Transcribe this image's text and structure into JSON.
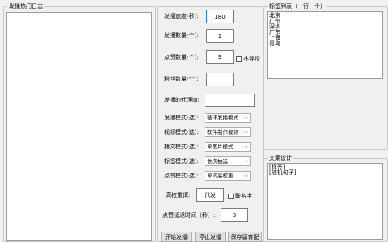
{
  "log_panel": {
    "title": "发播热门日志"
  },
  "settings": {
    "send_speed": {
      "label": "发播速度(秒):",
      "value": "180"
    },
    "send_count": {
      "label": "发播数量(个):",
      "value": "1"
    },
    "like_count": {
      "label": "点赞数量(个):",
      "value": "9"
    },
    "no_comment": {
      "label": "不评论"
    },
    "fans_count": {
      "label": "粉丝数量(个):",
      "value": ""
    },
    "proxy_ip": {
      "label": "发播的代理ip:",
      "value": ""
    },
    "send_mode": {
      "label": "发播模式(选):",
      "value": "循环发播模式"
    },
    "video_mode": {
      "label": "视频模式(选):",
      "value": "软件制作视频"
    },
    "image_mode": {
      "label": "播文模式(选):",
      "value": "单图片模式"
    },
    "tag_mode": {
      "label": "标签模式(选):",
      "value": "依次抽选"
    },
    "like_mode": {
      "label": "点赞模式(选):",
      "value": "单词高权重"
    },
    "high_weight_word": {
      "label": "高权重词:",
      "value": "代发"
    },
    "contact": {
      "label": "联名字"
    },
    "like_delay": {
      "label": "点赞延迟时间（秒）:",
      "value": "3"
    }
  },
  "buttons": {
    "start": "开始发播",
    "stop": "停止发播",
    "save": "保存留育配"
  },
  "tag_list": {
    "title": "标签列表（一行一个）",
    "items": [
      "北京",
      "广州",
      "深圳",
      "广东",
      "上海",
      "青岛"
    ]
  },
  "copy_design": {
    "title": "文案设计",
    "lines": [
      "[标签]",
      "[随机句子]"
    ]
  }
}
